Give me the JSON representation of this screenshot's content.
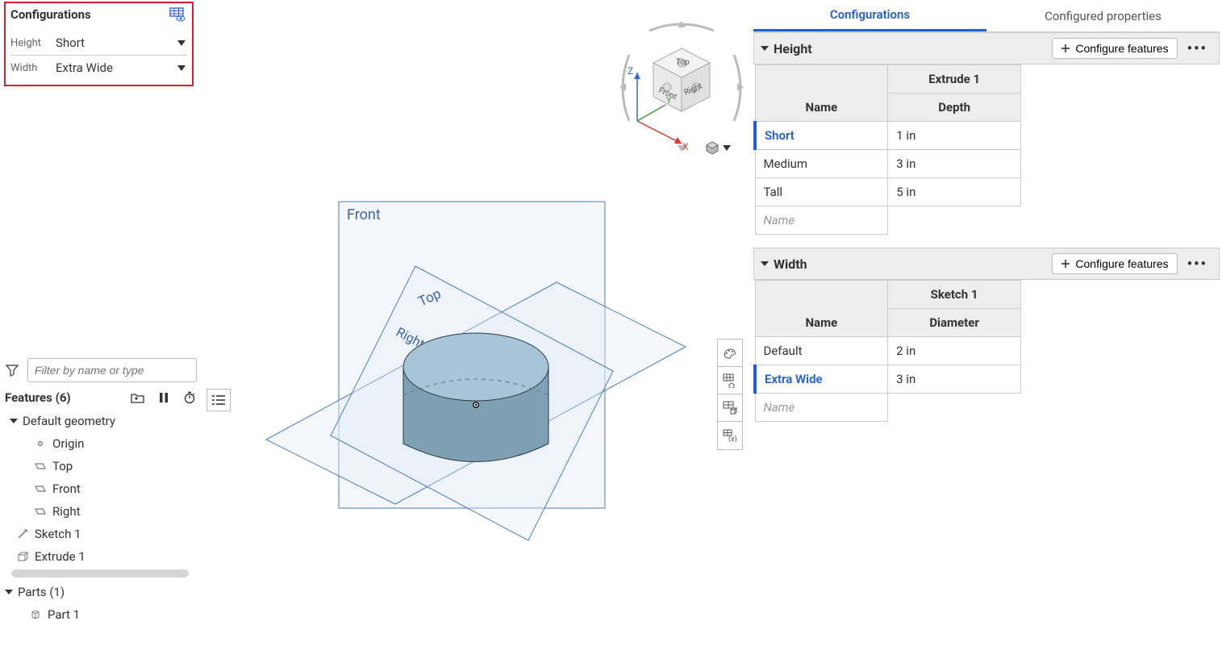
{
  "leftConfig": {
    "title": "Configurations",
    "rows": [
      {
        "label": "Height",
        "value": "Short"
      },
      {
        "label": "Width",
        "value": "Extra Wide"
      }
    ]
  },
  "viewport": {
    "planes": {
      "front": "Front",
      "top": "Top",
      "right": "Right"
    },
    "axes": {
      "x": "X",
      "y": "Y",
      "z": "Z"
    },
    "cube": {
      "top": "Top",
      "front": "Front",
      "right": "Right"
    }
  },
  "featurePanel": {
    "filterPlaceholder": "Filter by name or type",
    "featuresLabel": "Features (6)",
    "defaultGeometry": "Default geometry",
    "items": {
      "origin": "Origin",
      "top": "Top",
      "front": "Front",
      "right": "Right",
      "sketch1": "Sketch 1",
      "extrude1": "Extrude 1"
    },
    "partsLabel": "Parts (1)",
    "part1": "Part 1"
  },
  "rightPanel": {
    "tabs": {
      "configurations": "Configurations",
      "configuredProperties": "Configured properties"
    },
    "configureFeaturesLabel": "Configure features",
    "nameHeader": "Name",
    "placeholderName": "Name",
    "heightSection": {
      "title": "Height",
      "featureHeader": "Extrude 1",
      "paramHeader": "Depth",
      "rows": [
        {
          "name": "Short",
          "value": "1 in",
          "active": true
        },
        {
          "name": "Medium",
          "value": "3 in",
          "active": false
        },
        {
          "name": "Tall",
          "value": "5 in",
          "active": false
        }
      ]
    },
    "widthSection": {
      "title": "Width",
      "featureHeader": "Sketch 1",
      "paramHeader": "Diameter",
      "rows": [
        {
          "name": "Default",
          "value": "2 in",
          "active": false
        },
        {
          "name": "Extra Wide",
          "value": "3 in",
          "active": true
        }
      ]
    }
  }
}
